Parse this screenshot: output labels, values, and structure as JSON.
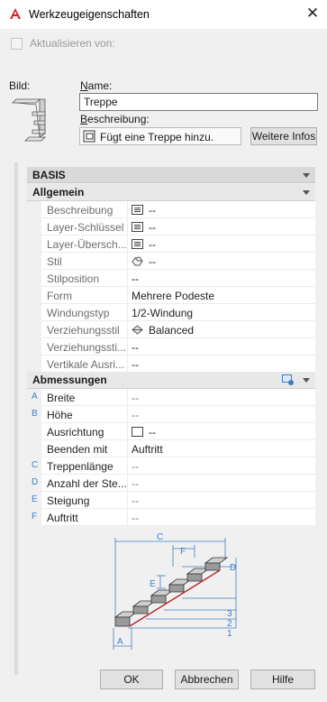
{
  "window": {
    "title": "Werkzeugeigenschaften",
    "close_glyph": "✕"
  },
  "update": {
    "label": "Aktualisieren von:",
    "checked": false
  },
  "image_label": "Bild:",
  "name": {
    "label": "Name:",
    "value": "Treppe"
  },
  "description": {
    "label": "Beschreibung:",
    "value": "Fügt eine Treppe hinzu.",
    "button": "Weitere Infos"
  },
  "basis": {
    "title": "BASIS",
    "allgemein": {
      "title": "Allgemein",
      "rows": [
        {
          "name": "Beschreibung",
          "value": "--",
          "icon": "list-icon"
        },
        {
          "name": "Layer-Schlüssel",
          "value": "--",
          "icon": "list-icon"
        },
        {
          "name": "Layer-Übersch...",
          "value": "--",
          "icon": "list-icon"
        },
        {
          "name": "Stil",
          "value": "--",
          "icon": "style-icon"
        },
        {
          "name": "Stilposition",
          "value": "--"
        },
        {
          "name": "Form",
          "value": "Mehrere Podeste"
        },
        {
          "name": "Windungstyp",
          "value": "1/2-Windung"
        },
        {
          "name": "Verziehungsstil",
          "value": "Balanced",
          "icon": "balanced-icon"
        },
        {
          "name": "Verziehungssti...",
          "value": "--"
        },
        {
          "name": "Vertikale Ausri...",
          "value": "--"
        }
      ]
    },
    "abmessungen": {
      "title": "Abmessungen",
      "rows": [
        {
          "letter": "A",
          "name": "Breite",
          "value": "--"
        },
        {
          "letter": "B",
          "name": "Höhe",
          "value": "--"
        },
        {
          "letter": "",
          "name": "Ausrichtung",
          "value": "--",
          "icon": "box-icon"
        },
        {
          "letter": "",
          "name": "Beenden mit",
          "value": "Auftritt"
        },
        {
          "letter": "C",
          "name": "Treppenlänge",
          "value": "--"
        },
        {
          "letter": "D",
          "name": "Anzahl der Ste...",
          "value": "--"
        },
        {
          "letter": "E",
          "name": "Steigung",
          "value": "--"
        },
        {
          "letter": "F",
          "name": "Auftritt",
          "value": "--"
        }
      ]
    }
  },
  "diagram_labels": {
    "c": "C",
    "f": "F",
    "e": "E",
    "d": "D",
    "a": "A",
    "n1": "1",
    "n2": "2",
    "n3": "3"
  },
  "buttons": {
    "ok": "OK",
    "cancel": "Abbrechen",
    "help": "Hilfe"
  },
  "colors": {
    "accent_blue": "#3b7fc8",
    "brand_red": "#d1222a"
  }
}
